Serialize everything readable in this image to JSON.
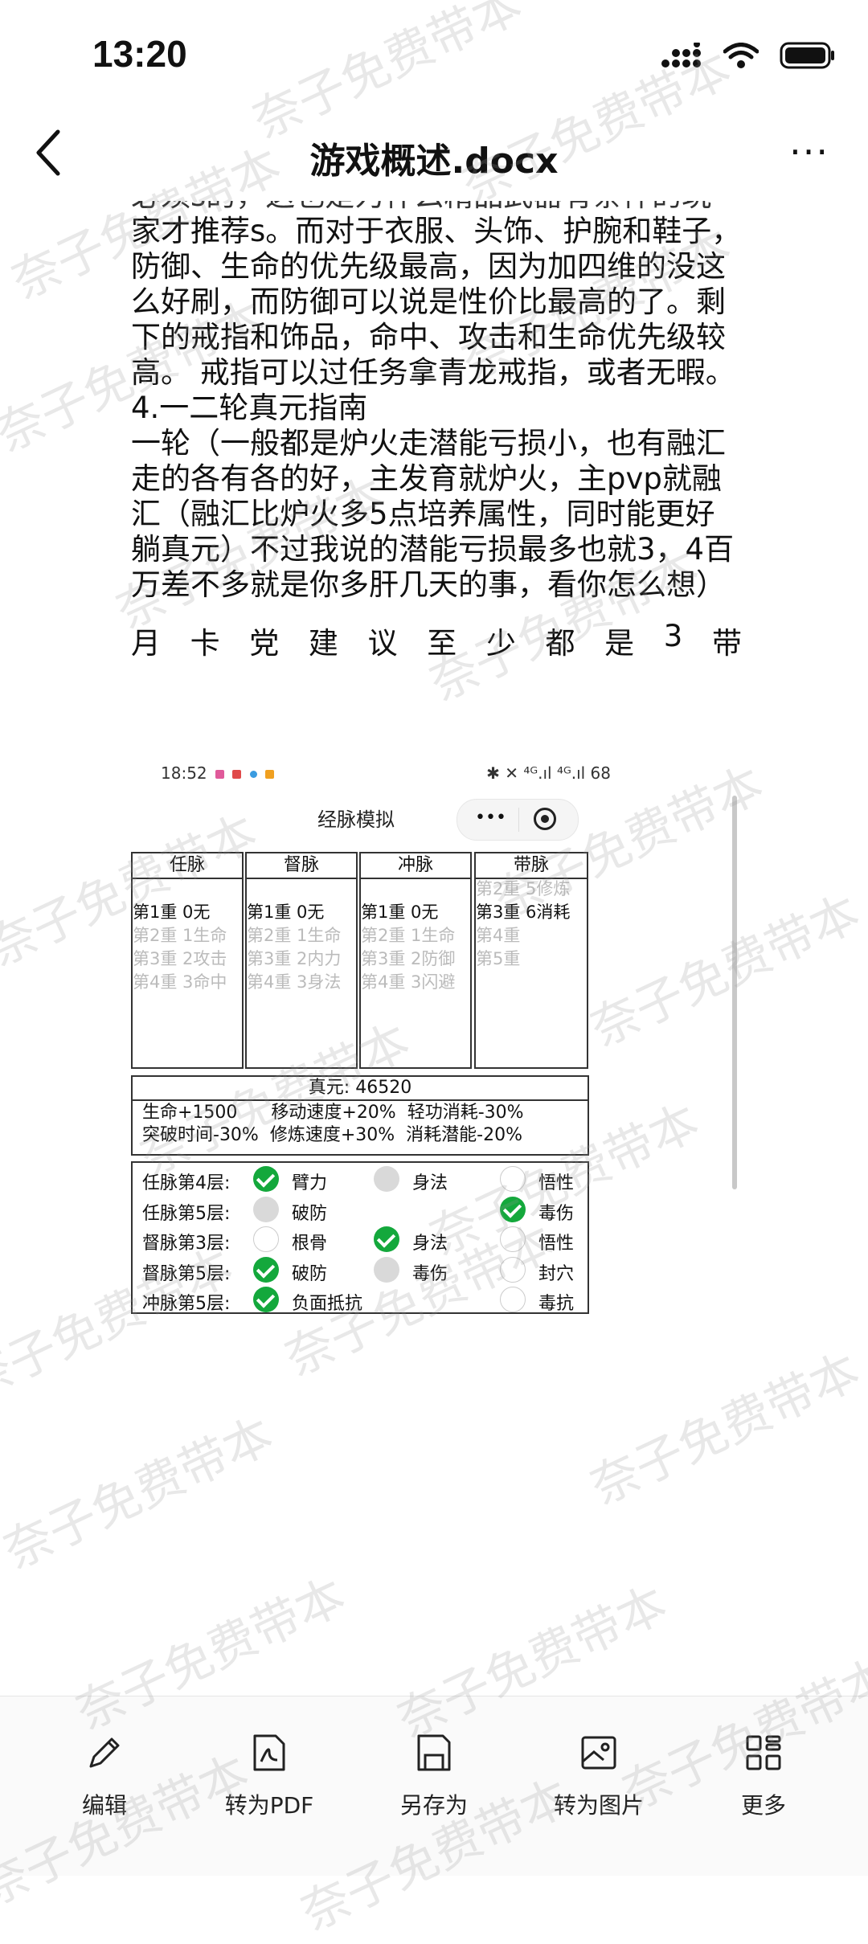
{
  "status": {
    "time": "13:20"
  },
  "nav": {
    "title": "游戏概述.docx",
    "more": "···"
  },
  "doc": {
    "cut_line": "必须s的，这也是为什么精品武器有条件的玩",
    "paragraphs": [
      "家才推荐s。而对于衣服、头饰、护腕和鞋子，防御、生命的优先级最高，因为加四维的没这么好刷，而防御可以说是性价比最高的了。剩下的戒指和饰品，命中、攻击和生命优先级较高。 戒指可以过任务拿青龙戒指，或者无暇。",
      "4.一二轮真元指南",
      "一轮（一般都是炉火走潜能亏损小，也有融汇走的各有各的好，主发育就炉火，主pvp就融汇（融汇比炉火多5点培养属性，同时能更好躺真元）不过我说的潜能亏损最多也就3，4百万差不多就是你多肝几天的事，看你怎么想）"
    ],
    "spread_chars": [
      "月",
      "卡",
      "党",
      "建",
      "议",
      "至",
      "少",
      "都",
      "是",
      "3",
      "带"
    ]
  },
  "shot": {
    "time": "18:52",
    "status_right": "✱ ✕ ⁴ᴳ.ıl ⁴ᴳ.ıl 68",
    "title": "经脉模拟",
    "columns": [
      {
        "name": "任脉",
        "lines": [
          {
            "t": "第1重 0无",
            "on": true
          },
          {
            "t": "第2重 1生命",
            "on": false
          },
          {
            "t": "第3重 2攻击",
            "on": false
          },
          {
            "t": "第4重 3命中",
            "on": false
          }
        ]
      },
      {
        "name": "督脉",
        "lines": [
          {
            "t": "第1重 0无",
            "on": true
          },
          {
            "t": "第2重 1生命",
            "on": false
          },
          {
            "t": "第3重 2内力",
            "on": false
          },
          {
            "t": "第4重 3身法",
            "on": false
          }
        ]
      },
      {
        "name": "冲脉",
        "lines": [
          {
            "t": "第1重 0无",
            "on": true
          },
          {
            "t": "第2重 1生命",
            "on": false
          },
          {
            "t": "第3重 2防御",
            "on": false
          },
          {
            "t": "第4重 3闪避",
            "on": false
          }
        ]
      },
      {
        "name": "带脉",
        "lines": [
          {
            "t": "第2重 5修炼",
            "on": false
          },
          {
            "t": "第3重 6消耗",
            "on": true
          },
          {
            "t": "第4重",
            "on": false
          },
          {
            "t": "第5重",
            "on": false
          }
        ]
      }
    ],
    "yuan": {
      "label": "真元:  46520",
      "bonus_line1": "生命+1500      移动速度+20%  轻功消耗-30%",
      "bonus_line2": "突破时间-30%  修炼速度+30%  消耗潜能-20%"
    },
    "rows": [
      {
        "label": "任脉第4层:",
        "opts": [
          {
            "t": "臂力",
            "state": "checked"
          },
          {
            "t": "身法",
            "state": "grey"
          },
          {
            "t": "悟性",
            "state": "none"
          }
        ]
      },
      {
        "label": "任脉第5层:",
        "opts": [
          {
            "t": "破防",
            "state": "grey"
          },
          null,
          {
            "t": "毒伤",
            "state": "checked"
          }
        ]
      },
      {
        "label": "督脉第3层:",
        "opts": [
          {
            "t": "根骨",
            "state": "none"
          },
          {
            "t": "身法",
            "state": "checked"
          },
          {
            "t": "悟性",
            "state": "none"
          }
        ]
      },
      {
        "label": "督脉第5层:",
        "opts": [
          {
            "t": "破防",
            "state": "checked"
          },
          {
            "t": "毒伤",
            "state": "grey"
          },
          {
            "t": "封穴",
            "state": "none"
          }
        ]
      },
      {
        "label": "冲脉第5层:",
        "opts": [
          {
            "t": "负面抵抗",
            "state": "checked"
          },
          null,
          {
            "t": "毒抗",
            "state": "none"
          }
        ]
      }
    ]
  },
  "toolbar": [
    {
      "label": "编辑",
      "icon": "pencil-icon"
    },
    {
      "label": "转为PDF",
      "icon": "pdf-icon"
    },
    {
      "label": "另存为",
      "icon": "save-icon"
    },
    {
      "label": "转为图片",
      "icon": "image-icon"
    },
    {
      "label": "更多",
      "icon": "grid-icon"
    }
  ],
  "watermark": "奈子免费带本"
}
